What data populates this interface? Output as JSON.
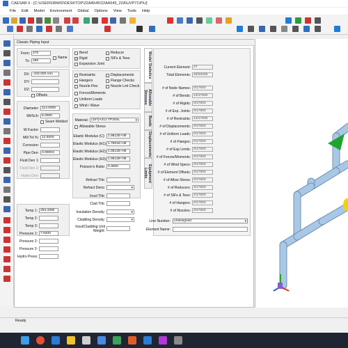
{
  "window": {
    "title": "CAESAR II - [C:\\USERS\\BWID\\DESKTOP\\22AA545\\22AA545_22A\\UVP71\\P\\U]"
  },
  "menu": [
    "File",
    "Edit",
    "Model",
    "Environment",
    "Global",
    "Options",
    "View",
    "Tools",
    "Help"
  ],
  "panel": {
    "title": "Classic Piping Input"
  },
  "node": {
    "from_label": "From:",
    "from": "470",
    "to_label": "To:",
    "to": "480",
    "name_label": "Name"
  },
  "delta": {
    "dx_label": "DX:",
    "dx": "-432.000 mm",
    "dy_label": "DY:",
    "dy": "",
    "dz_label": "DZ:",
    "dz": "",
    "offsets_label": "Offsets"
  },
  "pipe": {
    "diameter_label": "Diameter:",
    "diameter": "114.0000",
    "wt_label": "Wt/Sch:",
    "wt": "6.0000",
    "seam_label": "Seam Welded",
    "wfactor_label": "W Factor:",
    "wfactor": "",
    "mill_label": "Mill Tol %:",
    "mill": "12.5000",
    "corrosion_label": "Corrosion:",
    "corrosion": "",
    "pipeden_label": "Pipe Den:",
    "pipeden": "0.00003",
    "fluid1_label": "Fluid Den 1:",
    "fluid1": "",
    "fluid2_label": "Fluid Den 2:",
    "fluid2": "",
    "hydro_label": "Hydro Den:",
    "hydro": ""
  },
  "temps": [
    {
      "label": "Temp 1:",
      "value": "294.4300"
    },
    {
      "label": "Temp 2:",
      "value": ""
    },
    {
      "label": "Temp 3:",
      "value": ""
    }
  ],
  "pressures": [
    {
      "label": "Pressure 1:",
      "value": "7.8400"
    },
    {
      "label": "Pressure 2:",
      "value": ""
    },
    {
      "label": "Pressure 3:",
      "value": ""
    },
    {
      "label": "Hydro Press:",
      "value": ""
    }
  ],
  "checks1": [
    {
      "label": "Bend",
      "checked": false
    },
    {
      "label": "Rigid",
      "checked": true
    },
    {
      "label": "Expansion Joint",
      "checked": false
    }
  ],
  "checks2": [
    {
      "label": "Reducer",
      "checked": false
    },
    {
      "label": "SIFs & Tees",
      "checked": false
    }
  ],
  "checks3": [
    {
      "label": "Restraints",
      "checked": false
    },
    {
      "label": "Hangers",
      "checked": false
    },
    {
      "label": "Nozzle Flex",
      "checked": false
    },
    {
      "label": "Forces/Moments",
      "checked": false
    },
    {
      "label": "Uniform Loads",
      "checked": false
    },
    {
      "label": "Wind / Wave",
      "checked": false
    }
  ],
  "checks4": [
    {
      "label": "Displacements",
      "checked": false
    },
    {
      "label": "Flange Checks",
      "checked": false
    },
    {
      "label": "Nozzle Lmt Check",
      "checked": false
    }
  ],
  "material": {
    "material_label": "Material:",
    "material": "(157)A312 TP304L",
    "allow_label": "Allowable Stress",
    "moduli": [
      {
        "label": "Elastic Modulus (C):",
        "value": "1.9512E+08"
      },
      {
        "label": "Elastic Modulus (H1):",
        "value": "1.7801E+08"
      },
      {
        "label": "Elastic Modulus (H2):",
        "value": "1.9512E+08"
      },
      {
        "label": "Elastic Modulus (H3):",
        "value": "1.9512E+08"
      },
      {
        "label": "Poisson's Ratio:",
        "value": "0.3000"
      }
    ],
    "refract_thk_label": "Refract Thk:",
    "refract_den_label": "Refract Dens:",
    "insul_thk_label": "Insul Thk:",
    "clad_thk_label": "Clad Thk:",
    "insul_den_label": "Insulation Density:",
    "cladding_den_label": "Cladding Density:",
    "insul_clad_label": "Insul/Cladding Unit Weight:"
  },
  "tabs": [
    "Model Statistics",
    "Allowable Stresses",
    "Bends",
    "Displacements",
    "Equipment Limits"
  ],
  "stats": {
    "current_label": "Current Element:",
    "current": "47",
    "total_label": "Total Elements:",
    "total": "46/32000",
    "rows": [
      {
        "label": "# of Node Names:",
        "value": "0/17600"
      },
      {
        "label": "# of Bends:",
        "value": "13/17600"
      },
      {
        "label": "# of Rigids:",
        "value": "0/17600"
      },
      {
        "label": "# of Exp. Joints:",
        "value": "0/17600"
      },
      {
        "label": "# of Restraints:",
        "value": "13/17600"
      },
      {
        "label": "# of Displacements:",
        "value": "0/17600"
      },
      {
        "label": "# of Uniform Loads:",
        "value": "0/17600"
      },
      {
        "label": "# of Flanges:",
        "value": "0/17600"
      },
      {
        "label": "# of Exp Limits:",
        "value": "0/17600"
      },
      {
        "label": "# of Forces/Moments:",
        "value": "0/17600"
      },
      {
        "label": "# of Wind Specs:",
        "value": "0/17600"
      },
      {
        "label": "# of Element Offsets:",
        "value": "0/17600"
      },
      {
        "label": "# of Allow Stress:",
        "value": "0/17600"
      },
      {
        "label": "# of Reducers:",
        "value": "3/17600"
      },
      {
        "label": "# of SIFs & Tees:",
        "value": "2/17600"
      },
      {
        "label": "# of Hangers:",
        "value": "0/17600"
      },
      {
        "label": "# of Nozzles:",
        "value": "0/17600"
      }
    ],
    "line_label": "Line Number:",
    "line": "unassigned",
    "element_label": "Element Name:",
    "element": ""
  },
  "status": "Ready",
  "colors": {
    "pipe": "#a9c8e6",
    "pipe_edge": "#6f8fae",
    "green": "#1fa52f",
    "yellow": "#f0d400",
    "red": "#e0301e"
  }
}
